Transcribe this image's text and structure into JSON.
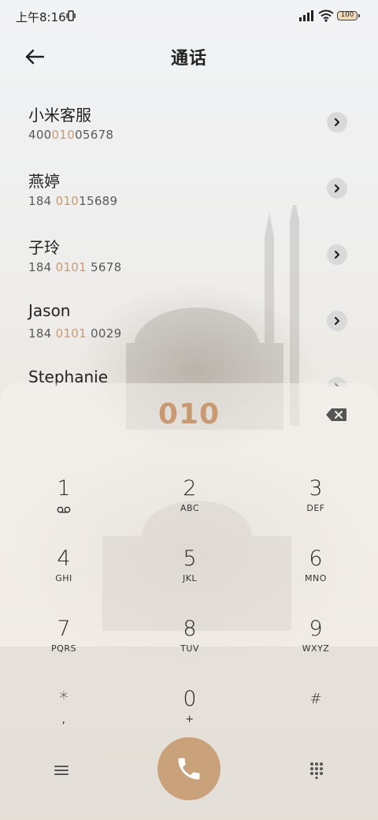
{
  "status_bar": {
    "time": "上午8:16",
    "battery": "100"
  },
  "header": {
    "title": "通话"
  },
  "contacts": [
    {
      "name": "小米客服",
      "num_pre": "400",
      "num_hl": "010",
      "num_post": "05678"
    },
    {
      "name": "燕婷",
      "num_pre": "184 ",
      "num_hl": "010",
      "num_post": "15689"
    },
    {
      "name": "子玲",
      "num_pre": "184 ",
      "num_hl": "0101",
      "num_post": " 5678"
    },
    {
      "name": "Jason",
      "num_pre": "184 ",
      "num_hl": "0101",
      "num_post": " 0029"
    },
    {
      "name": "Stephanie",
      "num_pre": "",
      "num_hl": "",
      "num_post": ""
    }
  ],
  "dial_input": "010",
  "keys": [
    {
      "digit": "1",
      "letters": ""
    },
    {
      "digit": "2",
      "letters": "ABC"
    },
    {
      "digit": "3",
      "letters": "DEF"
    },
    {
      "digit": "4",
      "letters": "GHI"
    },
    {
      "digit": "5",
      "letters": "JKL"
    },
    {
      "digit": "6",
      "letters": "MNO"
    },
    {
      "digit": "7",
      "letters": "PQRS"
    },
    {
      "digit": "8",
      "letters": "TUV"
    },
    {
      "digit": "9",
      "letters": "WXYZ"
    },
    {
      "digit": "*",
      "letters": ","
    },
    {
      "digit": "0",
      "letters": "+"
    },
    {
      "digit": "#",
      "letters": ""
    }
  ],
  "colors": {
    "accent": "#c99a72",
    "call_button": "#c9a27c",
    "detail_button": "#d9d9d9"
  },
  "icons": {
    "status": [
      "vibrate-icon",
      "signal-icon",
      "wifi-icon",
      "battery-icon"
    ],
    "header": "back-arrow-icon",
    "row": "chevron-right-icon",
    "key1": "voicemail-icon",
    "input": "backspace-icon",
    "bottom": [
      "menu-icon",
      "phone-icon",
      "dialpad-icon"
    ]
  }
}
